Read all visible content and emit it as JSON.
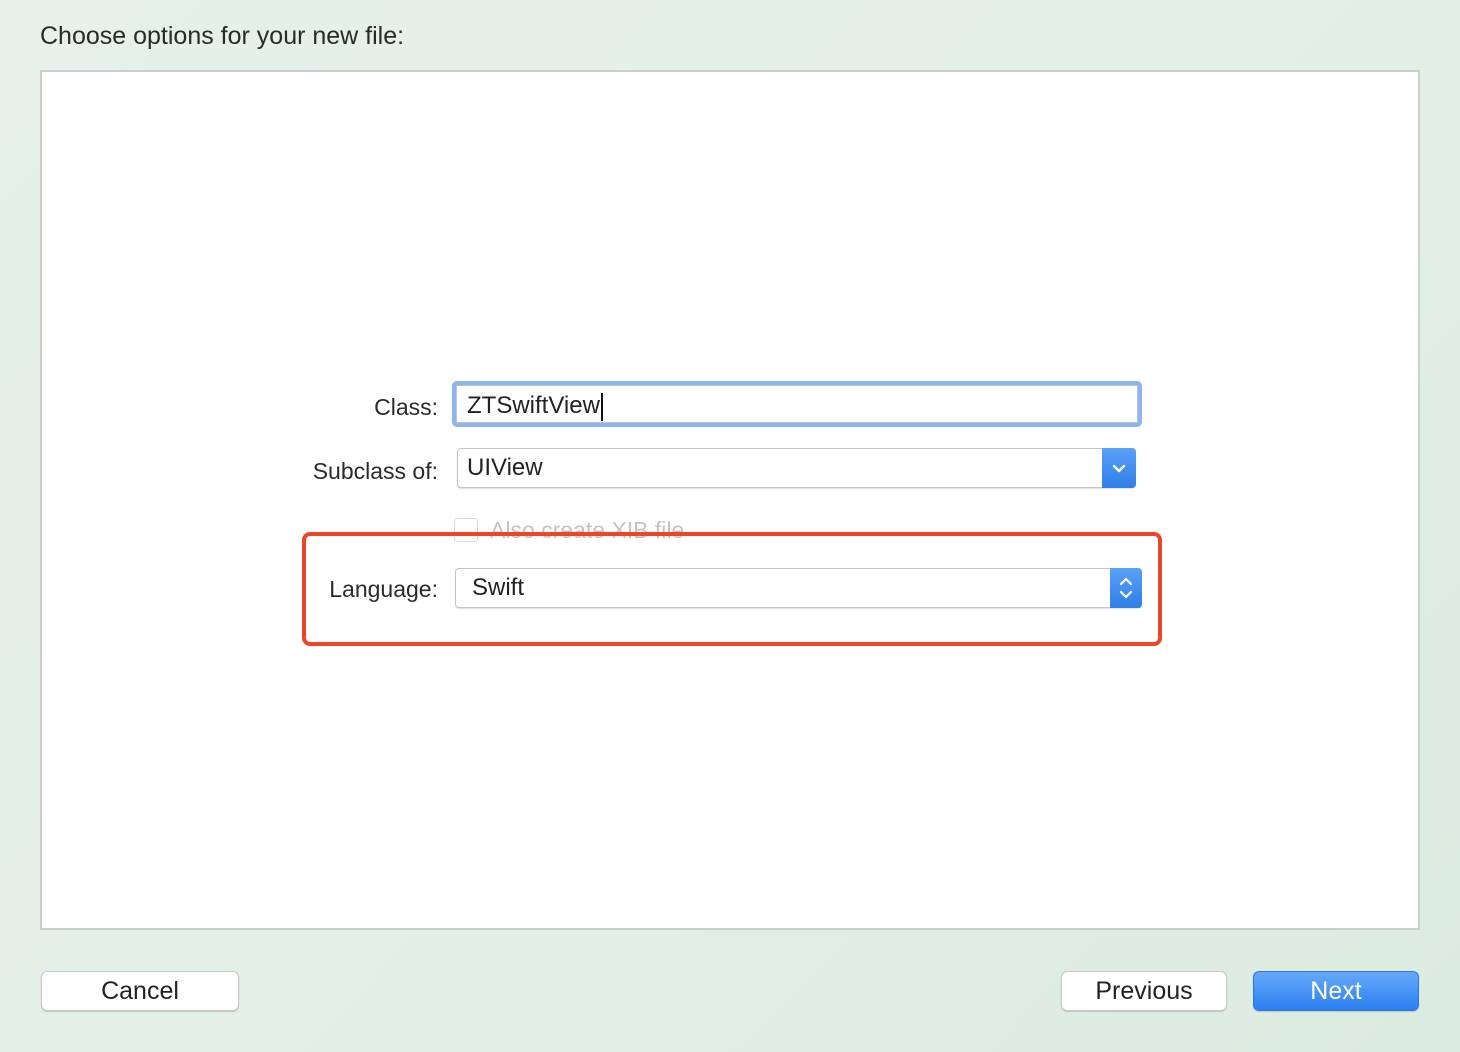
{
  "dialog": {
    "heading": "Choose options for your new file:"
  },
  "form": {
    "class_label": "Class:",
    "class_value": "ZTSwiftView",
    "subclass_label": "Subclass of:",
    "subclass_value": "UIView",
    "xib_label": "Also create XIB file",
    "xib_checked": false,
    "xib_enabled": false,
    "language_label": "Language:",
    "language_value": "Swift"
  },
  "highlight": {
    "color": "#ee4427"
  },
  "buttons": {
    "cancel": "Cancel",
    "previous": "Previous",
    "next": "Next"
  },
  "colors": {
    "accent": "#2f7fe8",
    "focus_ring": "#8db4ee"
  }
}
